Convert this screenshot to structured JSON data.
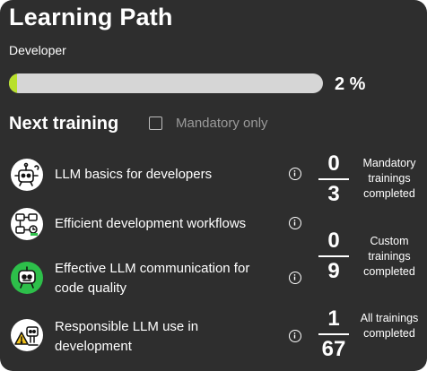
{
  "header": {
    "title": "Learning Path",
    "subtitle": "Developer"
  },
  "progress": {
    "value": 0.02,
    "label": "2 %",
    "fill_color": "#b8e02c"
  },
  "next_training": {
    "title": "Next training",
    "filter_label": "Mandatory only",
    "filter_checked": false,
    "items": [
      {
        "label": "LLM basics for developers",
        "icon": "robot-brain-icon"
      },
      {
        "label": "Efficient development workflows",
        "icon": "workflow-icon"
      },
      {
        "label": "Effective LLM communication for code quality",
        "icon": "chat-robot-icon"
      },
      {
        "label": "Responsible LLM use in development",
        "icon": "warning-robot-icon"
      }
    ]
  },
  "stats": [
    {
      "completed": "0",
      "total": "3",
      "label": "Mandatory trainings completed"
    },
    {
      "completed": "0",
      "total": "9",
      "label": "Custom trainings completed"
    },
    {
      "completed": "1",
      "total": "67",
      "label": "All trainings completed"
    }
  ],
  "colors": {
    "card_background": "#2e2e2e",
    "track": "#d6d6d6",
    "accent_green": "#b8e02c",
    "icon_green": "#2dbf4a"
  }
}
